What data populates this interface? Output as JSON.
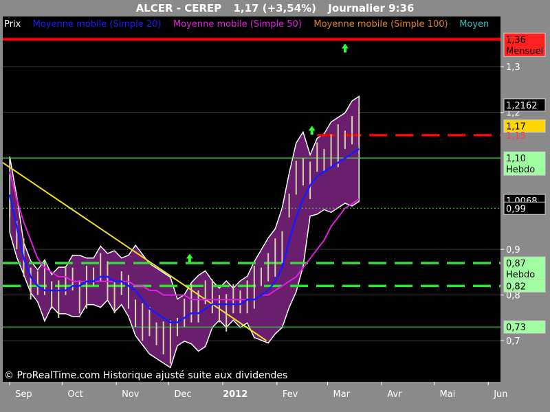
{
  "header": {
    "symbol": "ALCER - CEREP",
    "quote": "1,17 (+3,54%)",
    "period": "Journalier  9:36"
  },
  "legend": [
    {
      "label": "Prix",
      "color": "#ffffff"
    },
    {
      "label": "Moyenne mobile (Simple 20)",
      "color": "#1a1aff"
    },
    {
      "label": "Moyenne mobile (Simple 50)",
      "color": "#e020e0"
    },
    {
      "label": "Moyenne mobile (Simple 100)",
      "color": "#e08020"
    },
    {
      "label": "Moyen",
      "color": "#30c0c0"
    }
  ],
  "credit": "© ProRealTime.com Historique ajusté suite aux dividendes",
  "colors": {
    "background": "#000000",
    "frame": "#8a8a8a",
    "band_fill": "#6a1f6e",
    "price": "#d8d2a8",
    "ma20": "#1a1aff",
    "ma50": "#e020e0",
    "ma100": "#e08020",
    "ma200": "#30c0c0",
    "trendline": "#f0e020",
    "resistance": "#ff0000",
    "support": "#30e030",
    "arrow": "#30ff30"
  },
  "chart_data": {
    "type": "line",
    "x_ticks": [
      "Sep",
      "Oct",
      "Nov",
      "Dec",
      "2012",
      "Fev",
      "Mar",
      "Avr",
      "Mai",
      "Jun"
    ],
    "y_ticks": [
      "1,3",
      "1,2",
      "0,9",
      "0,8",
      "0,7"
    ],
    "ylim": [
      0.61,
      1.41
    ],
    "price_series": {
      "name": "Prix",
      "x": [
        "2011-09-01",
        "2011-09-05",
        "2011-09-09",
        "2011-09-13",
        "2011-09-17",
        "2011-09-21",
        "2011-09-25",
        "2011-09-29",
        "2011-10-03",
        "2011-10-07",
        "2011-10-11",
        "2011-10-15",
        "2011-10-19",
        "2011-10-23",
        "2011-10-27",
        "2011-10-31",
        "2011-11-04",
        "2011-11-08",
        "2011-11-12",
        "2011-11-16",
        "2011-11-20",
        "2011-11-24",
        "2011-11-28",
        "2011-12-02",
        "2011-12-06",
        "2011-12-10",
        "2011-12-14",
        "2011-12-18",
        "2011-12-22",
        "2011-12-26",
        "2011-12-30",
        "2012-01-03",
        "2012-01-07",
        "2012-01-11",
        "2012-01-15",
        "2012-01-19",
        "2012-01-23",
        "2012-01-27",
        "2012-01-31",
        "2012-02-04",
        "2012-02-08",
        "2012-02-12",
        "2012-02-16",
        "2012-02-20",
        "2012-02-24",
        "2012-02-28",
        "2012-03-03",
        "2012-03-07",
        "2012-03-11",
        "2012-03-15",
        "2012-03-19"
      ],
      "values": [
        0.99,
        0.93,
        0.88,
        0.84,
        0.82,
        0.83,
        0.81,
        0.8,
        0.82,
        0.84,
        0.8,
        0.82,
        0.84,
        0.86,
        0.83,
        0.81,
        0.82,
        0.8,
        0.77,
        0.75,
        0.73,
        0.72,
        0.71,
        0.7,
        0.73,
        0.76,
        0.78,
        0.79,
        0.8,
        0.79,
        0.78,
        0.77,
        0.78,
        0.79,
        0.8,
        0.82,
        0.84,
        0.86,
        0.88,
        0.92,
        0.99,
        1.05,
        1.08,
        1.06,
        1.09,
        1.1,
        1.12,
        1.13,
        1.14,
        1.16,
        1.17
      ]
    },
    "series": [
      {
        "name": "Moyenne mobile (Simple 20)",
        "color": "#1a1aff",
        "values": [
          1.02,
          0.95,
          0.88,
          0.84,
          0.82,
          0.81,
          0.81,
          0.81,
          0.81,
          0.82,
          0.82,
          0.83,
          0.83,
          0.84,
          0.84,
          0.83,
          0.83,
          0.82,
          0.81,
          0.79,
          0.77,
          0.76,
          0.75,
          0.74,
          0.74,
          0.75,
          0.76,
          0.76,
          0.77,
          0.78,
          0.78,
          0.78,
          0.78,
          0.78,
          0.79,
          0.79,
          0.8,
          0.81,
          0.83,
          0.86,
          0.92,
          0.97,
          1.01,
          1.04,
          1.06,
          1.07,
          1.08,
          1.09,
          1.1,
          1.11,
          1.12
        ]
      },
      {
        "name": "Moyenne mobile (Simple 50)",
        "color": "#e020e0",
        "values": [
          1.07,
          1.01,
          0.96,
          0.92,
          0.88,
          0.86,
          0.85,
          0.84,
          0.84,
          0.83,
          0.83,
          0.83,
          0.83,
          0.83,
          0.83,
          0.83,
          0.83,
          0.83,
          0.82,
          0.82,
          0.81,
          0.81,
          0.8,
          0.8,
          0.8,
          0.8,
          0.79,
          0.79,
          0.79,
          0.79,
          0.79,
          0.79,
          0.79,
          0.79,
          0.79,
          0.79,
          0.8,
          0.8,
          0.81,
          0.82,
          0.83,
          0.84,
          0.86,
          0.88,
          0.9,
          0.92,
          0.95,
          0.97,
          0.99,
          1.0,
          1.01
        ]
      }
    ],
    "levels": [
      {
        "value": 1.36,
        "label": "1,36",
        "sublabel": "Mensuel",
        "color": "#ff0000"
      },
      {
        "value": 1.15,
        "label": "1,15",
        "color": "#ff0000"
      },
      {
        "value": 1.1,
        "label": "1,10",
        "sublabel": "Hebdo",
        "color": "#30e030"
      },
      {
        "value": 0.87,
        "label": "0,87",
        "sublabel": "Hebdo",
        "color": "#30e030"
      },
      {
        "value": 0.82,
        "label": "0,82",
        "color": "#30e030"
      },
      {
        "value": 0.73,
        "label": "0,73",
        "color": "#30e030"
      }
    ],
    "value_labels": [
      {
        "value": 1.2162,
        "label": "1,2162",
        "kind": "bollinger-upper"
      },
      {
        "value": 1.17,
        "label": "1,17",
        "kind": "last-price"
      },
      {
        "value": 1.0068,
        "label": "1,0068",
        "kind": "bollinger-lower"
      },
      {
        "value": 0.99,
        "label": "0,99",
        "kind": "level"
      }
    ]
  }
}
